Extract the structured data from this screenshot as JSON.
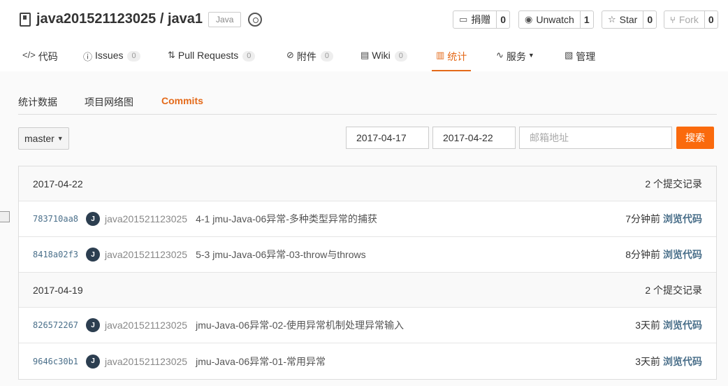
{
  "repo": {
    "name": "java201521123025 / java1",
    "language": "Java"
  },
  "actions": [
    {
      "label": "捐赠",
      "count": "0",
      "icon": "donate-icon",
      "disabled": false
    },
    {
      "label": "Unwatch",
      "count": "1",
      "icon": "eye-icon",
      "disabled": false
    },
    {
      "label": "Star",
      "count": "0",
      "icon": "star-icon",
      "disabled": false
    },
    {
      "label": "Fork",
      "count": "0",
      "icon": "fork-icon",
      "disabled": true
    }
  ],
  "nav": [
    {
      "label": "代码",
      "count": null,
      "icon": "code-icon"
    },
    {
      "label": "Issues",
      "count": "0",
      "icon": "issue-icon"
    },
    {
      "label": "Pull Requests",
      "count": "0",
      "icon": "pull-request-icon"
    },
    {
      "label": "附件",
      "count": "0",
      "icon": "attachment-icon"
    },
    {
      "label": "Wiki",
      "count": "0",
      "icon": "wiki-icon"
    },
    {
      "label": "统计",
      "count": null,
      "icon": "chart-icon",
      "active": true
    },
    {
      "label": "服务",
      "count": null,
      "icon": "pulse-icon"
    },
    {
      "label": "管理",
      "count": null,
      "icon": "settings-doc-icon"
    }
  ],
  "subnav": [
    {
      "label": "统计数据"
    },
    {
      "label": "项目网络图"
    },
    {
      "label": "Commits",
      "active": true
    }
  ],
  "filter": {
    "branch": "master",
    "start_date": "2017-04-17",
    "end_date": "2017-04-22",
    "email_placeholder": "邮箱地址",
    "search_label": "搜索"
  },
  "groups": [
    {
      "date": "2017-04-22",
      "count_label": "2 个提交记录",
      "commits": [
        {
          "sha": "783710aa8",
          "avatar": "J",
          "author": "java201521123025",
          "message": "4-1 jmu-Java-06异常-多种类型异常的捕获",
          "time": "7分钟前",
          "browse": "浏览代码"
        },
        {
          "sha": "8418a02f3",
          "avatar": "J",
          "author": "java201521123025",
          "message": "5-3 jmu-Java-06异常-03-throw与throws",
          "time": "8分钟前",
          "browse": "浏览代码"
        }
      ]
    },
    {
      "date": "2017-04-19",
      "count_label": "2 个提交记录",
      "commits": [
        {
          "sha": "826572267",
          "avatar": "J",
          "author": "java201521123025",
          "message": "jmu-Java-06异常-02-使用异常机制处理异常输入",
          "time": "3天前",
          "browse": "浏览代码"
        },
        {
          "sha": "9646c30b1",
          "avatar": "J",
          "author": "java201521123025",
          "message": "jmu-Java-06异常-01-常用异常",
          "time": "3天前",
          "browse": "浏览代码"
        }
      ]
    }
  ]
}
